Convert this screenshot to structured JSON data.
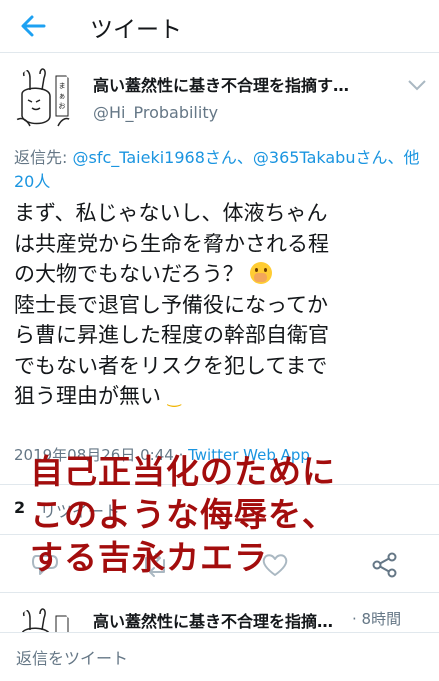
{
  "appbar": {
    "title": "ツイート",
    "back_icon": "back-arrow-icon"
  },
  "tweet": {
    "author_name": "高い蓋然性に基き不合理を指摘す…",
    "handle": "@Hi_Probability",
    "reply_prefix": "返信先: ",
    "reply_mention_1": "@sfc_Taieki1968さん",
    "reply_separator": "、",
    "reply_mention_2": "@365Takabuさん",
    "reply_separator_2": "、",
    "reply_others": "他20人",
    "body_line_1": "まず、私じゃないし、体液ちゃん",
    "body_line_2": "は共産党から生命を脅かされる程",
    "body_line_3": "の大物でもないだろう？",
    "body_line_4": "陸士長で退官し予備役になってか",
    "body_line_5": "ら曹に昇進した程度の幹部自衛官",
    "body_line_6": "でもない者をリスクを犯してまで",
    "body_line_7": "狙う理由が無い",
    "timestamp": "2019年08月26日 0:44 · ",
    "app": "Twitter Web App",
    "retweet_count": "2",
    "retweet_label": "リツイート"
  },
  "overlay": {
    "line_1": "自己正当化のために",
    "line_2": "このような侮辱を、",
    "line_3": "する吉永カエラ"
  },
  "next_tweet": {
    "author_name": "高い蓋然性に基き不合理を指摘…",
    "time": "· 8時間"
  },
  "composer": {
    "placeholder": "返信をツイート"
  },
  "colors": {
    "accent": "#1b95e0",
    "overlay_text": "#a30d0d",
    "muted": "#657786"
  }
}
